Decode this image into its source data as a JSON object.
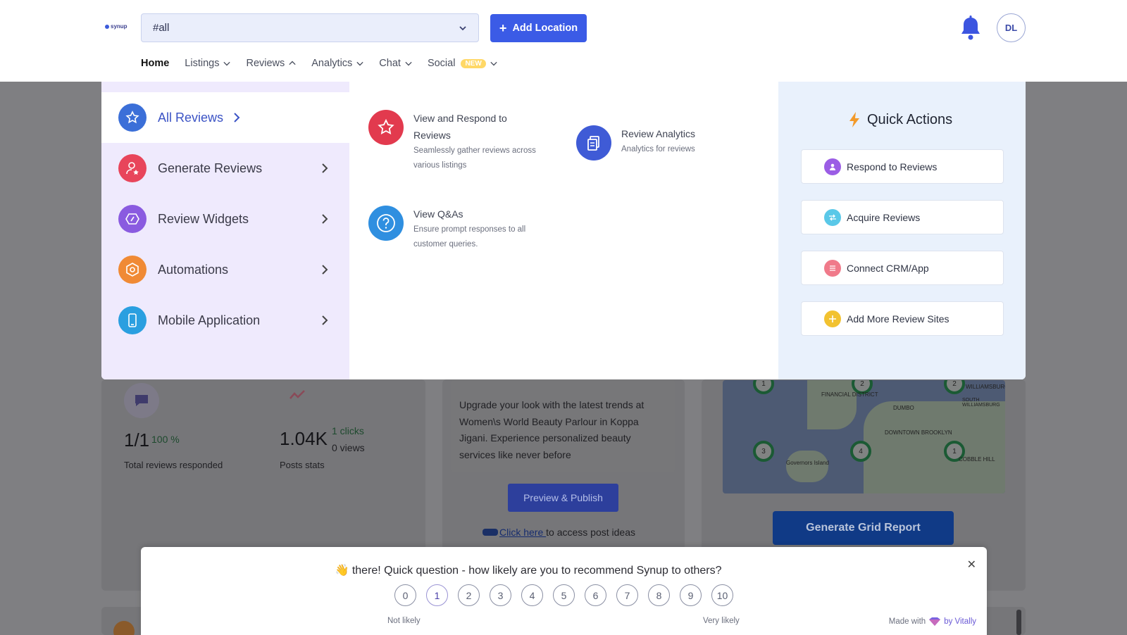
{
  "brand": {
    "logo_text": "synup"
  },
  "header": {
    "location_select_value": "#all",
    "add_location_label": "Add Location",
    "avatar_initials": "DL"
  },
  "nav": {
    "home": "Home",
    "listings": "Listings",
    "reviews": "Reviews",
    "analytics": "Analytics",
    "chat": "Chat",
    "social": "Social",
    "social_badge": "NEW"
  },
  "menu": {
    "categories": [
      {
        "label": "All Reviews",
        "icon": "star-badge-icon",
        "color": "#3b6fd8"
      },
      {
        "label": "Generate Reviews",
        "icon": "user-star-icon",
        "color": "#e8455b"
      },
      {
        "label": "Review Widgets",
        "icon": "widget-icon",
        "color": "#8a5be0"
      },
      {
        "label": "Automations",
        "icon": "cog-hex-icon",
        "color": "#f08a35"
      },
      {
        "label": "Mobile Application",
        "icon": "phone-icon",
        "color": "#2a9fe0"
      }
    ],
    "features": [
      {
        "title": "View and Respond to Reviews",
        "desc": "Seamlessly gather reviews across various listings",
        "icon": "star-icon"
      },
      {
        "title": "Review Analytics",
        "desc": "Analytics for reviews",
        "icon": "documents-icon"
      },
      {
        "title": "View Q&As",
        "desc": "Ensure prompt responses to all customer queries.",
        "icon": "question-icon"
      }
    ],
    "quick_actions_title": "Quick Actions",
    "quick_actions": [
      {
        "label": "Respond to Reviews",
        "color": "#9b5de5"
      },
      {
        "label": "Acquire Reviews",
        "color": "#5ac8e8"
      },
      {
        "label": "Connect CRM/App",
        "color": "#f07a8a"
      },
      {
        "label": "Add More Review Sites",
        "color": "#f2c230"
      }
    ]
  },
  "background": {
    "reviews_ratio": "1/1",
    "reviews_pct": "100 %",
    "reviews_caption": "Total reviews responded",
    "posts_value": "1.04K",
    "posts_clicks": "1 clicks",
    "posts_views": "0 views",
    "posts_caption": "Posts stats",
    "post_text": "Upgrade your look with the latest trends at Women\\s World Beauty Parlour in Koppa Jigani. Experience personalized beauty services like never before",
    "preview_publish": "Preview & Publish",
    "click_here": "Click here ",
    "post_ideas_suffix": "to access post ideas",
    "generate_grid_report": "Generate Grid Report",
    "map_labels": [
      "FINANCIAL DISTRICT",
      "DUMBO",
      "DOWNTOWN BROOKLYN",
      "Governors Island",
      "WILLIAMSBURG",
      "SOUTH WILLIAMSBURG",
      "COBBLE HILL"
    ],
    "map_pins": [
      "1",
      "3",
      "2",
      "3",
      "4",
      "1"
    ]
  },
  "survey": {
    "question": "👋 there! Quick question - how likely are you to recommend Synup to others?",
    "scale": [
      "0",
      "1",
      "2",
      "3",
      "4",
      "5",
      "6",
      "7",
      "8",
      "9",
      "10"
    ],
    "low_label": "Not likely",
    "high_label": "Very likely",
    "made_with": "Made with",
    "by": "by Vitally"
  }
}
